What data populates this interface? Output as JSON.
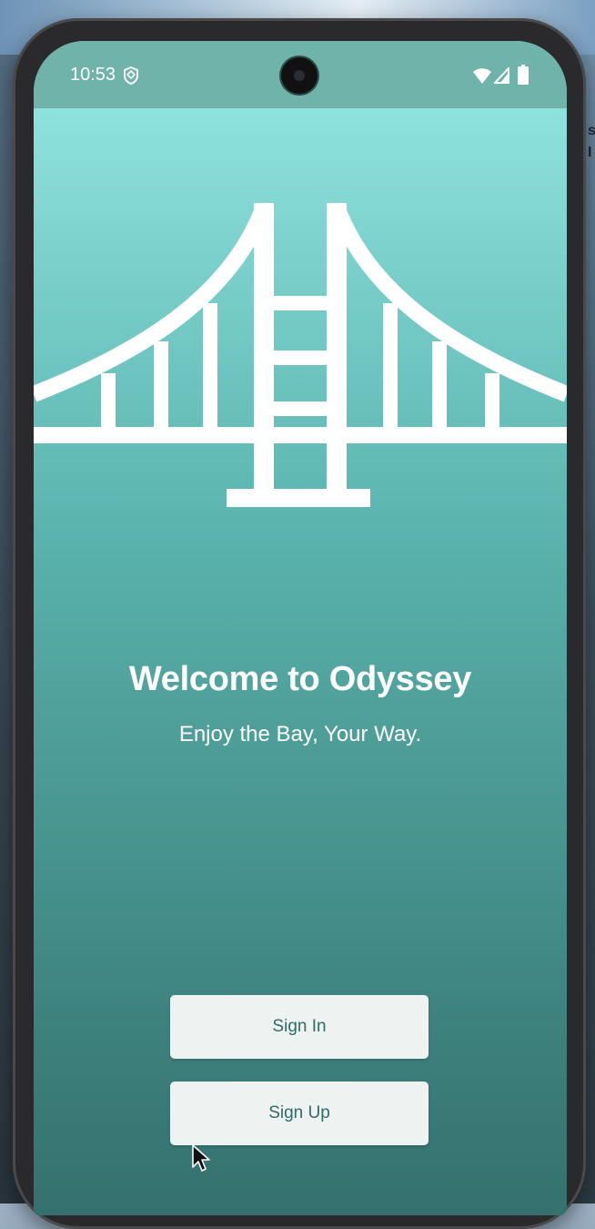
{
  "status_bar": {
    "time": "10:53",
    "icons": [
      "shield-icon",
      "wifi-icon",
      "signal-icon",
      "battery-icon"
    ]
  },
  "background": {
    "edge_text": "s\nI"
  },
  "app": {
    "logo_icon": "bridge-icon",
    "title": "Welcome to Odyssey",
    "tagline": "Enjoy the Bay, Your Way.",
    "buttons": {
      "sign_in": "Sign In",
      "sign_up": "Sign Up"
    }
  },
  "colors": {
    "gradient_top": "#96ebe6",
    "gradient_bottom": "#35716e",
    "button_bg": "#eef3f2",
    "button_text": "#2f6b67",
    "text": "#ffffff"
  }
}
